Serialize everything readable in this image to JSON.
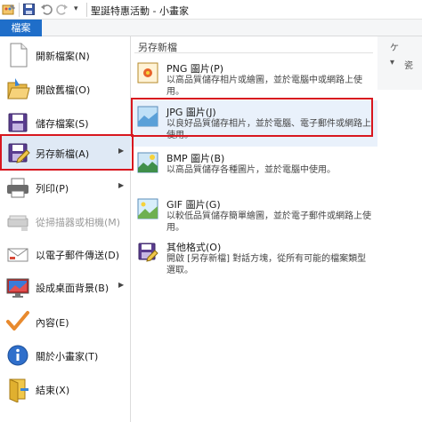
{
  "title_bar": {
    "title": "聖誕特惠活動 - 小畫家"
  },
  "ribbon": {
    "file_tab_label": "檔案",
    "right_items": [
      "ケ",
      "▾",
      "瓷"
    ]
  },
  "left_menu": {
    "items": [
      {
        "label": "開新檔案(N)",
        "icon": "new-file-icon",
        "has_submenu": false,
        "enabled": true
      },
      {
        "label": "開啟舊檔(O)",
        "icon": "open-folder-icon",
        "has_submenu": false,
        "enabled": true
      },
      {
        "label": "儲存檔案(S)",
        "icon": "save-disk-icon",
        "has_submenu": false,
        "enabled": true
      },
      {
        "label": "另存新檔(A)",
        "icon": "save-as-icon",
        "has_submenu": true,
        "enabled": true
      },
      {
        "label": "列印(P)",
        "icon": "printer-icon",
        "has_submenu": true,
        "enabled": true
      },
      {
        "label": "從掃描器或相機(M)",
        "icon": "scanner-icon",
        "has_submenu": false,
        "enabled": false
      },
      {
        "label": "以電子郵件傳送(D)",
        "icon": "email-icon",
        "has_submenu": false,
        "enabled": true
      },
      {
        "label": "設成桌面背景(B)",
        "icon": "desktop-background-icon",
        "has_submenu": true,
        "enabled": true
      },
      {
        "label": "內容(E)",
        "icon": "checkmark-icon",
        "has_submenu": false,
        "enabled": true
      },
      {
        "label": "關於小畫家(T)",
        "icon": "info-icon",
        "has_submenu": false,
        "enabled": true
      },
      {
        "label": "結束(X)",
        "icon": "exit-icon",
        "has_submenu": false,
        "enabled": true
      }
    ]
  },
  "submenu": {
    "header": "另存新檔",
    "items": [
      {
        "title": "PNG 圖片(P)",
        "description": "以高品質儲存相片或繪圖，並於電腦中或網路上使用。",
        "icon": "png-image-icon"
      },
      {
        "title": "JPG 圖片(J)",
        "description": "以良好品質儲存相片，並於電腦、電子郵件或網路上使用。",
        "icon": "jpg-image-icon"
      },
      {
        "title": "BMP 圖片(B)",
        "description": "以高品質儲存各種圖片，並於電腦中使用。",
        "icon": "bmp-image-icon"
      },
      {
        "title": "GIF 圖片(G)",
        "description": "以較低品質儲存簡單繪圖，並於電子郵件或網路上使用。",
        "icon": "gif-image-icon"
      },
      {
        "title": "其他格式(O)",
        "description": "開啟 [另存新檔] 對話方塊，從所有可能的檔案類型選取。",
        "icon": "other-formats-icon"
      }
    ]
  },
  "colors": {
    "file_tab": "#1f6ec9",
    "highlight_box": "#d8171f",
    "active_item_bg": "#dfe9f5"
  }
}
